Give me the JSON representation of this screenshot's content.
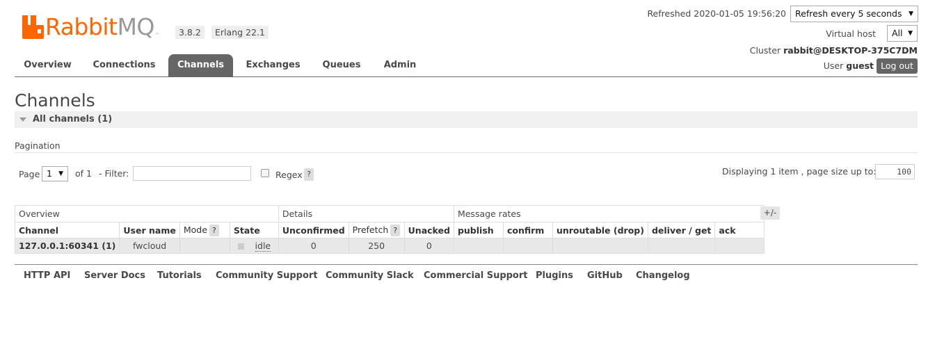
{
  "brand": {
    "name_part1": "Rabbit",
    "name_part2": "MQ",
    "trademark": "™",
    "version": "3.8.2",
    "erlang": "Erlang 22.1"
  },
  "header": {
    "refreshed_label": "Refreshed 2020-01-05 19:56:20",
    "refresh_option": "Refresh every 5 seconds",
    "vhost_label": "Virtual host",
    "vhost_value": "All",
    "cluster_label": "Cluster",
    "cluster_value": "rabbit@DESKTOP-375C7DM",
    "user_label": "User",
    "user_value": "guest",
    "logout_label": "Log out"
  },
  "tabs": [
    {
      "label": "Overview",
      "active": false
    },
    {
      "label": "Connections",
      "active": false
    },
    {
      "label": "Channels",
      "active": true
    },
    {
      "label": "Exchanges",
      "active": false
    },
    {
      "label": "Queues",
      "active": false
    },
    {
      "label": "Admin",
      "active": false
    }
  ],
  "page": {
    "title": "Channels",
    "section_label": "All channels (1)",
    "pagination_heading": "Pagination",
    "page_label": "Page",
    "page_value": "1",
    "of_label": "of 1",
    "filter_label": "- Filter:",
    "filter_value": "",
    "regex_label": "Regex",
    "help_glyph": "?",
    "displaying_label": "Displaying 1 item , page size up to:",
    "page_size_value": "100"
  },
  "table": {
    "groups": [
      "Overview",
      "Details",
      "Message rates"
    ],
    "columns": [
      "Channel",
      "User name",
      "Mode",
      "State",
      "Unconfirmed",
      "Prefetch",
      "Unacked",
      "publish",
      "confirm",
      "unroutable (drop)",
      "deliver / get",
      "ack"
    ],
    "rows": [
      {
        "channel": "127.0.0.1:60341 (1)",
        "user": "fwcloud",
        "mode": "",
        "state": "idle",
        "unconfirmed": "0",
        "prefetch": "250",
        "unacked": "0",
        "publish": "",
        "confirm": "",
        "unroutable": "",
        "deliver_get": "",
        "ack": ""
      }
    ],
    "toggle_label": "+/-"
  },
  "footer": {
    "links": [
      "HTTP API",
      "Server Docs",
      "Tutorials",
      "Community Support",
      "Community Slack",
      "Commercial Support",
      "Plugins",
      "GitHub",
      "Changelog"
    ]
  },
  "colors": {
    "brand_orange": "#ff6600",
    "tab_active_bg": "#666666",
    "row_bg": "#e8e8e8"
  }
}
